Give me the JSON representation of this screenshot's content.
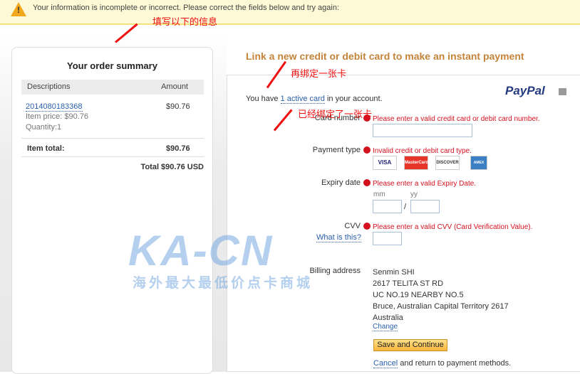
{
  "alert": {
    "message": "Your information is incomplete or incorrect. Please correct the fields below and try again:"
  },
  "annotations": {
    "fill_info": "填写以下的信息",
    "bind_another": "再绑定一张卡",
    "already_bound": "已经绑定了一张卡"
  },
  "watermark": {
    "logo": "KA-CN",
    "slogan": "海外最大最低价点卡商城"
  },
  "order": {
    "title": "Your order summary",
    "col_desc": "Descriptions",
    "col_amount": "Amount",
    "item_id": "2014080183368",
    "item_price": "Item price: $90.76",
    "quantity": "Quantity:1",
    "item_amount": "$90.76",
    "item_total_label": "Item total:",
    "item_total": "$90.76",
    "total": "Total $90.76 USD"
  },
  "form": {
    "title": "Link a new credit or debit card to make an instant payment",
    "brand": "PayPal",
    "you_have": "You have",
    "active_card": "1 active card",
    "in_account": "in your account.",
    "card_number_label": "Card number",
    "card_number_error": "Please enter a valid credit card or debit card number.",
    "payment_type_label": "Payment type",
    "payment_type_error": "Invalid credit or debit card type.",
    "cards": [
      "VISA",
      "MasterCard",
      "DISCOVER",
      "AMEX"
    ],
    "expiry_label": "Expiry date",
    "expiry_error": "Please enter a valid Expiry Date.",
    "mm": "mm",
    "yy": "yy",
    "slash": "/",
    "cvv_label": "CVV",
    "cvv_error": "Please enter a valid CVV (Card Verification Value).",
    "what_is_this": "What is this?",
    "billing_label": "Billing address",
    "address": [
      "Senmin SHI",
      "2617 TELITA ST RD",
      "UC NO.19 NEARBY NO.5",
      "Bruce, Australian Capital Territory 2617",
      "Australia"
    ],
    "change": "Change",
    "save": "Save and Continue",
    "cancel": "Cancel",
    "cancel_rest": "and return to payment methods."
  }
}
